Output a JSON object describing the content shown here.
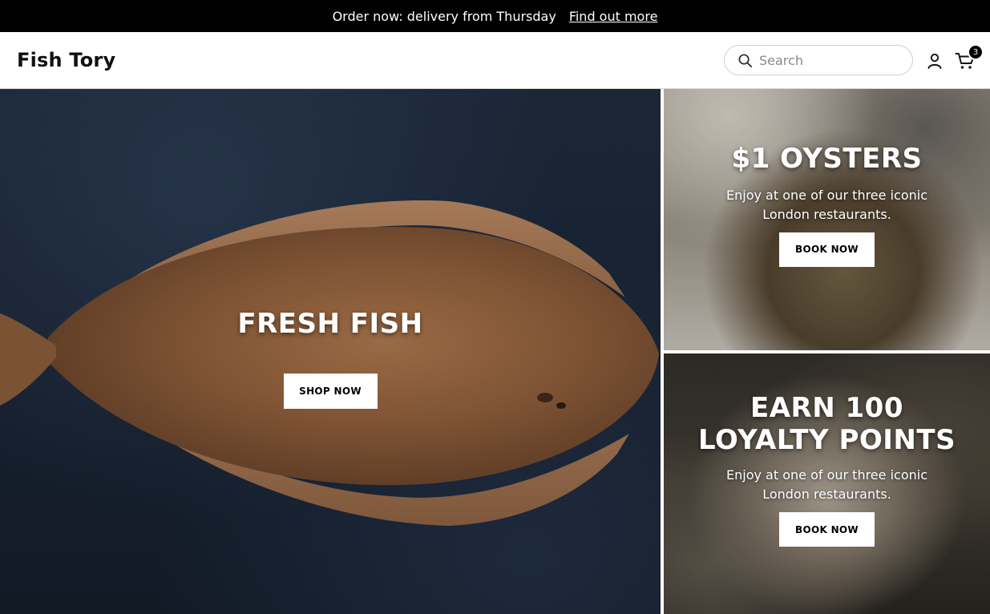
{
  "announcement": {
    "message": "Order now: delivery from Thursday",
    "link_label": "Find out more"
  },
  "header": {
    "logo": "Fish Tory",
    "search_placeholder": "Search",
    "cart_count": "3",
    "icons": [
      "search-icon",
      "account-icon",
      "cart-icon"
    ]
  },
  "hero": {
    "main": {
      "title": "FRESH FISH",
      "button_label": "SHOP NOW"
    },
    "oysters": {
      "title": "$1 OYSTERS",
      "text": "Enjoy at one of our three iconic London restaurants.",
      "button_label": "BOOK NOW"
    },
    "loyalty": {
      "title": "EARN 100 LOYALTY POINTS",
      "text": "Enjoy at one of our three iconic London restaurants.",
      "button_label": "BOOK NOW"
    }
  },
  "colors": {
    "announcement_bg": "#000000",
    "header_bg": "#ffffff",
    "button_bg": "#ffffff",
    "button_text": "#000000",
    "badge_bg": "#000000"
  }
}
